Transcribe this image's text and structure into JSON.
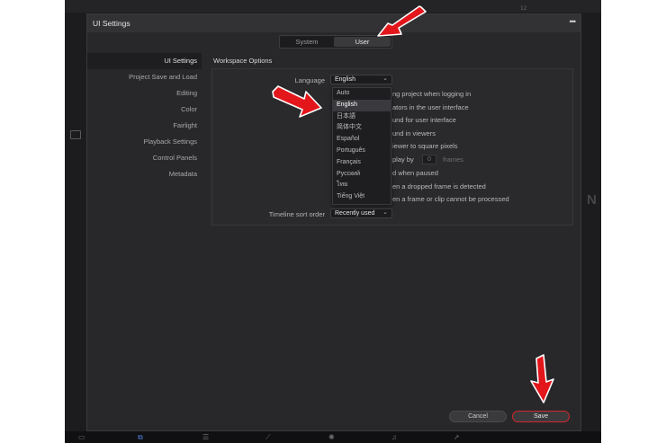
{
  "app": {
    "timecode_fragment": "12"
  },
  "dialog": {
    "title": "UI Settings",
    "menu_glyph": "•••"
  },
  "tabs": [
    {
      "label": "System",
      "active": false
    },
    {
      "label": "User",
      "active": true
    }
  ],
  "sidebar": {
    "items": [
      {
        "label": "UI Settings",
        "active": true
      },
      {
        "label": "Project Save and Load",
        "active": false
      },
      {
        "label": "Editing",
        "active": false
      },
      {
        "label": "Color",
        "active": false
      },
      {
        "label": "Fairlight",
        "active": false
      },
      {
        "label": "Playback Settings",
        "active": false
      },
      {
        "label": "Control Panels",
        "active": false
      },
      {
        "label": "Metadata",
        "active": false
      }
    ]
  },
  "workspace": {
    "section_title": "Workspace Options",
    "language_label": "Language",
    "language_value": "English",
    "options": [
      "ng project when logging in",
      "ators in the user interface",
      "und for user interface",
      "und in viewers",
      "iewer to square pixels",
      "play by",
      "frames",
      "d when paused",
      "en a dropped frame is detected",
      "en a frame or clip cannot be processed"
    ],
    "replay_frames_value": "0",
    "timeline_sort_label": "Timeline sort order",
    "timeline_sort_value": "Recently used"
  },
  "language_dropdown": {
    "selected": "English",
    "options": [
      "Auto",
      "English",
      "日本語",
      "简体中文",
      "Español",
      "Português",
      "Français",
      "Русский",
      "ไทย",
      "Tiếng Việt"
    ]
  },
  "footer": {
    "cancel_label": "Cancel",
    "save_label": "Save"
  },
  "annotation": {
    "arrow_color": "#e3161b"
  },
  "colors": {
    "accent_save_border": "#d2282a",
    "dock_active": "#4c7bd6"
  }
}
